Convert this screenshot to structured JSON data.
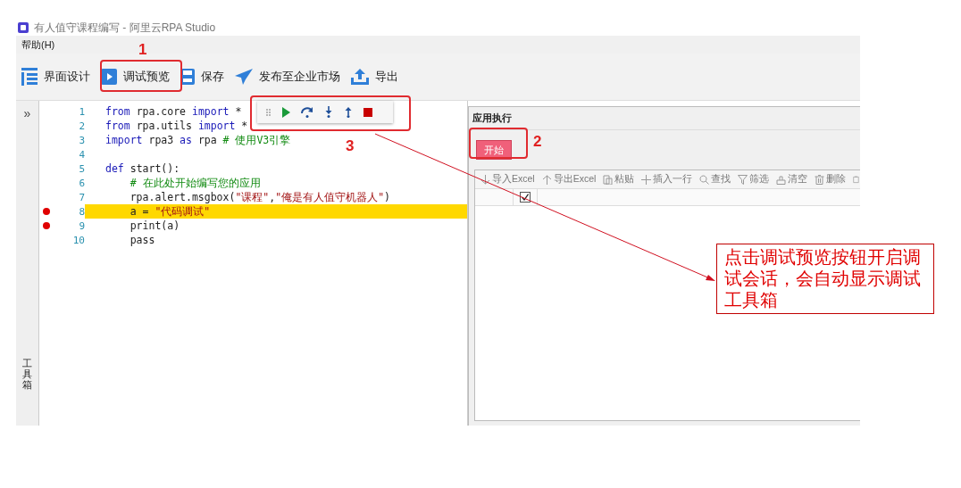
{
  "window": {
    "title": "有人值守课程编写 - 阿里云RPA Studio"
  },
  "menu": [
    "帮助(H)"
  ],
  "toolbar": [
    {
      "label": "界面设计",
      "kind": "design"
    },
    {
      "label": "调试预览",
      "kind": "debug"
    },
    {
      "label": "保存",
      "kind": "save"
    },
    {
      "label": "发布至企业市场",
      "kind": "publish"
    },
    {
      "label": "导出",
      "kind": "export"
    }
  ],
  "sidebar": {
    "toggle": "»",
    "label": "工具箱"
  },
  "editor": {
    "lines": [
      {
        "number": "1",
        "breakpoint": false,
        "current": false,
        "tokens": [
          {
            "text": "from",
            "kind": "keyword"
          },
          {
            "text": " rpa.core ",
            "kind": "plain"
          },
          {
            "text": "import",
            "kind": "keyword"
          },
          {
            "text": " *",
            "kind": "plain"
          }
        ]
      },
      {
        "number": "2",
        "breakpoint": false,
        "current": false,
        "tokens": [
          {
            "text": "from",
            "kind": "keyword"
          },
          {
            "text": " rpa.utils ",
            "kind": "plain"
          },
          {
            "text": "import",
            "kind": "keyword"
          },
          {
            "text": " *",
            "kind": "plain"
          }
        ]
      },
      {
        "number": "3",
        "breakpoint": false,
        "current": false,
        "tokens": [
          {
            "text": "import",
            "kind": "keyword"
          },
          {
            "text": " rpa3 ",
            "kind": "plain"
          },
          {
            "text": "as",
            "kind": "keyword"
          },
          {
            "text": " rpa ",
            "kind": "plain"
          },
          {
            "text": "# 使用V3引擎",
            "kind": "comment"
          }
        ]
      },
      {
        "number": "4",
        "breakpoint": false,
        "current": false
      },
      {
        "number": "5",
        "breakpoint": false,
        "current": false,
        "tokens": [
          {
            "text": "def",
            "kind": "keyword"
          },
          {
            "text": " start():",
            "kind": "plain"
          }
        ]
      },
      {
        "number": "6",
        "breakpoint": false,
        "current": false,
        "tokens": [
          {
            "text": "    # 在此处开始编写您的应用",
            "kind": "comment"
          }
        ]
      },
      {
        "number": "7",
        "breakpoint": false,
        "current": false,
        "tokens": [
          {
            "text": "    rpa.alert.msgbox(",
            "kind": "plain"
          },
          {
            "text": "\"课程\"",
            "kind": "string"
          },
          {
            "text": ",",
            "kind": "plain"
          },
          {
            "text": "\"俺是有人值守机器人\"",
            "kind": "string"
          },
          {
            "text": ")",
            "kind": "plain"
          }
        ]
      },
      {
        "number": "8",
        "breakpoint": true,
        "current": true,
        "tokens": [
          {
            "text": "    a = ",
            "kind": "plain"
          },
          {
            "text": "\"代码调试\"",
            "kind": "string"
          }
        ]
      },
      {
        "number": "9",
        "breakpoint": true,
        "current": false,
        "tokens": [
          {
            "text": "    print(a)",
            "kind": "plain"
          }
        ]
      },
      {
        "number": "10",
        "breakpoint": false,
        "current": false,
        "tokens": [
          {
            "text": "    pass",
            "kind": "plain"
          }
        ]
      }
    ]
  },
  "run_panel": {
    "title": "应用执行",
    "start_button": "开始",
    "grid_toolbar": [
      {
        "label": "导入Excel",
        "kind": "import"
      },
      {
        "label": "导出Excel",
        "kind": "export"
      },
      {
        "label": "粘贴",
        "kind": "paste"
      },
      {
        "label": "插入一行",
        "kind": "insert"
      },
      {
        "label": "查找",
        "kind": "find"
      },
      {
        "label": "筛选",
        "kind": "filter"
      },
      {
        "label": "清空",
        "kind": "clear"
      },
      {
        "label": "删除",
        "kind": "delete"
      }
    ],
    "header_checkbox": {
      "checked": true
    }
  },
  "annotations": {
    "markers": [
      "1",
      "2",
      "3"
    ],
    "callout": "点击调试预览按钮开启调试会话，会自动显示调试工具箱"
  }
}
